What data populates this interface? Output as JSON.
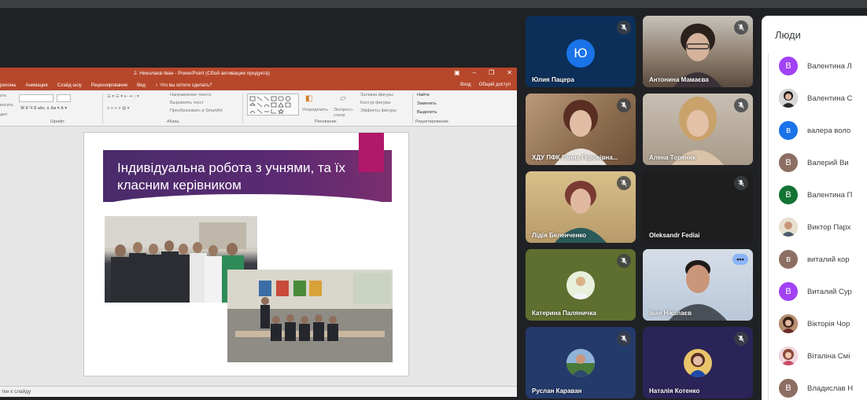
{
  "ppt": {
    "window_title": "2. Николаєв Іван - PowerPoint (Сбой активации продукта)",
    "tabs": [
      "рехоны",
      "Анимация",
      "Слайд-шоу",
      "Рецензирование",
      "Вид",
      "♀ Что вы хотите сделать?"
    ],
    "tab_right": [
      "Вход",
      "Общий доступ"
    ],
    "ribbon": {
      "group_font": "Шрифт",
      "group_paragraph": "Абзац",
      "group_drawing": "Рисование",
      "group_editing": "Редактирование",
      "text_direction": "Направление текста",
      "align_text": "Выровнять текст",
      "convert_smartart": "Преобразовать в SmartArt",
      "arrange": "Упорядочить",
      "quick_styles": "Экспресс-стили",
      "shape_fill": "Заливка фигуры",
      "shape_outline": "Контур фигуры",
      "shape_effects": "Эффекты фигуры",
      "find": "Найти",
      "replace": "Заменить",
      "select": "Выделить",
      "left_labels": [
        "ать",
        "восить",
        "дел"
      ]
    },
    "slide_title": "Індивідуальна робота з учнями, та їх класним керівником",
    "status_text": "тки к слайду"
  },
  "colors": {
    "ppt_accent": "#b7472a",
    "banner_purple": "#4a2b6b",
    "slide_accent": "#b0186a",
    "meet_bg": "#202124",
    "active_outline": "#8ab4f8"
  },
  "tiles": [
    {
      "name": "Юлия Пацера",
      "initial": "Ю",
      "avatar_color": "#1a73e8",
      "bg": "#0b2f59"
    },
    {
      "name": "Антонина Мамаєва",
      "bg": "#8a7a6a"
    },
    {
      "name": "ХДУ ПФК Ганна Геронівна...",
      "bg": "#9a7d5e"
    },
    {
      "name": "Алена Торяник",
      "bg": "#a89a88"
    },
    {
      "name": "Лідія Беленченко",
      "bg": "#b79a6a"
    },
    {
      "name": "Oleksandr Fediai",
      "bg": "#1e1e1e"
    },
    {
      "name": "Катерина Паляничка",
      "bg": "#5f6f2f"
    },
    {
      "name": "Іван Ніколаєв",
      "bg": "#b9c7d8"
    },
    {
      "name": "Руслан Караван",
      "bg": "#243a6b"
    },
    {
      "name": "Наталія Котенко",
      "bg": "#2b2458"
    }
  ],
  "people": {
    "title": "Люди",
    "list": [
      {
        "name": "Валентина Л",
        "initial": "В",
        "color": "#a142f4"
      },
      {
        "name": "Валентина С",
        "initial": "",
        "color": "#5f6368"
      },
      {
        "name": "валера воло",
        "initial": "в",
        "color": "#1a73e8"
      },
      {
        "name": "Валерий Ви",
        "initial": "В",
        "color": "#8d6e63"
      },
      {
        "name": "Валентина П",
        "initial": "В",
        "color": "#137333"
      },
      {
        "name": "Виктор Парх",
        "initial": "",
        "color": "#c8a57a"
      },
      {
        "name": "виталий кор",
        "initial": "в",
        "color": "#8d6e63"
      },
      {
        "name": "Виталий Сур",
        "initial": "В",
        "color": "#a142f4"
      },
      {
        "name": "Вікторія Чор",
        "initial": "",
        "color": "#7a4a2a"
      },
      {
        "name": "Віталіна Смі",
        "initial": "",
        "color": "#c8788a"
      },
      {
        "name": "Владислав Н",
        "initial": "В",
        "color": "#8d6e63"
      }
    ]
  }
}
